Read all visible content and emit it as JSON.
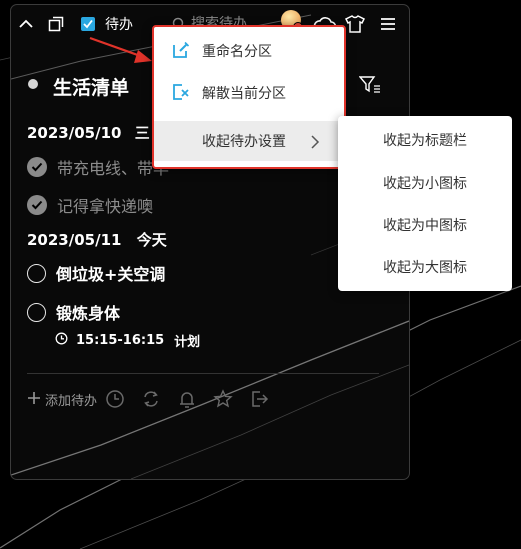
{
  "toolbar": {
    "icons": [
      "chevron-up-icon",
      "restore-window-icon",
      "checkbox-icon",
      "search-icon",
      "avatar",
      "cloud-icon",
      "tshirt-icon",
      "menu-icon"
    ],
    "app_label": "待办",
    "search_placeholder": "搜索待办",
    "accent_color": "#2aa7e0"
  },
  "list": {
    "title": "生活清单",
    "groups": [
      {
        "date": "2023/05/10",
        "suffix": "三",
        "items": [
          {
            "text": "带充电线、带毕",
            "done": true
          },
          {
            "text": "记得拿快递噢",
            "done": true
          }
        ]
      },
      {
        "date": "2023/05/11",
        "suffix": "今天",
        "items": [
          {
            "text": "倒垃圾+关空调",
            "done": false
          },
          {
            "text": "锻炼身体",
            "done": false,
            "time": "15:15-16:15",
            "plan": "计划"
          }
        ]
      }
    ]
  },
  "bottom_bar": {
    "add_label": "添加待办",
    "icons": [
      "clock-icon",
      "repeat-icon",
      "bell-icon",
      "star-icon",
      "move-out-icon"
    ]
  },
  "context_menu": {
    "items": [
      {
        "label": "重命名分区",
        "icon": "rename-icon"
      },
      {
        "label": "解散当前分区",
        "icon": "dissolve-icon"
      },
      {
        "label": "收起待办设置",
        "icon": "chevron-right-icon"
      }
    ],
    "highlight_color": "#e0332a"
  },
  "submenu": {
    "items": [
      "收起为标题栏",
      "收起为小图标",
      "收起为中图标",
      "收起为大图标"
    ]
  }
}
